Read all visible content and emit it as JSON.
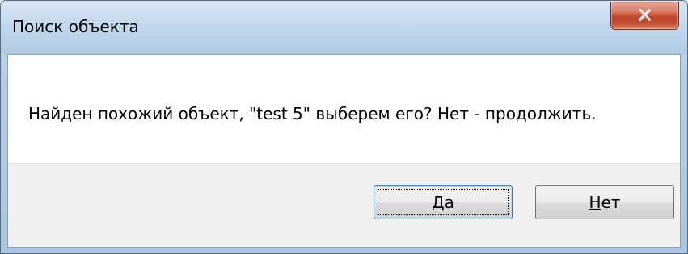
{
  "window": {
    "title": "Поиск объекта",
    "close_icon": "close-icon"
  },
  "dialog": {
    "message": "Найден похожий объект, \"test 5\" выберем его? Нет - продолжить."
  },
  "buttons": {
    "yes": {
      "mnemonic": "Д",
      "rest": "а"
    },
    "no": {
      "mnemonic": "Н",
      "rest": "ет"
    }
  },
  "colors": {
    "close_button": "#c7432b",
    "title_bar": "#b9d1ea",
    "button_area": "#f0f0f0",
    "default_button_border": "#3c7fb1"
  }
}
